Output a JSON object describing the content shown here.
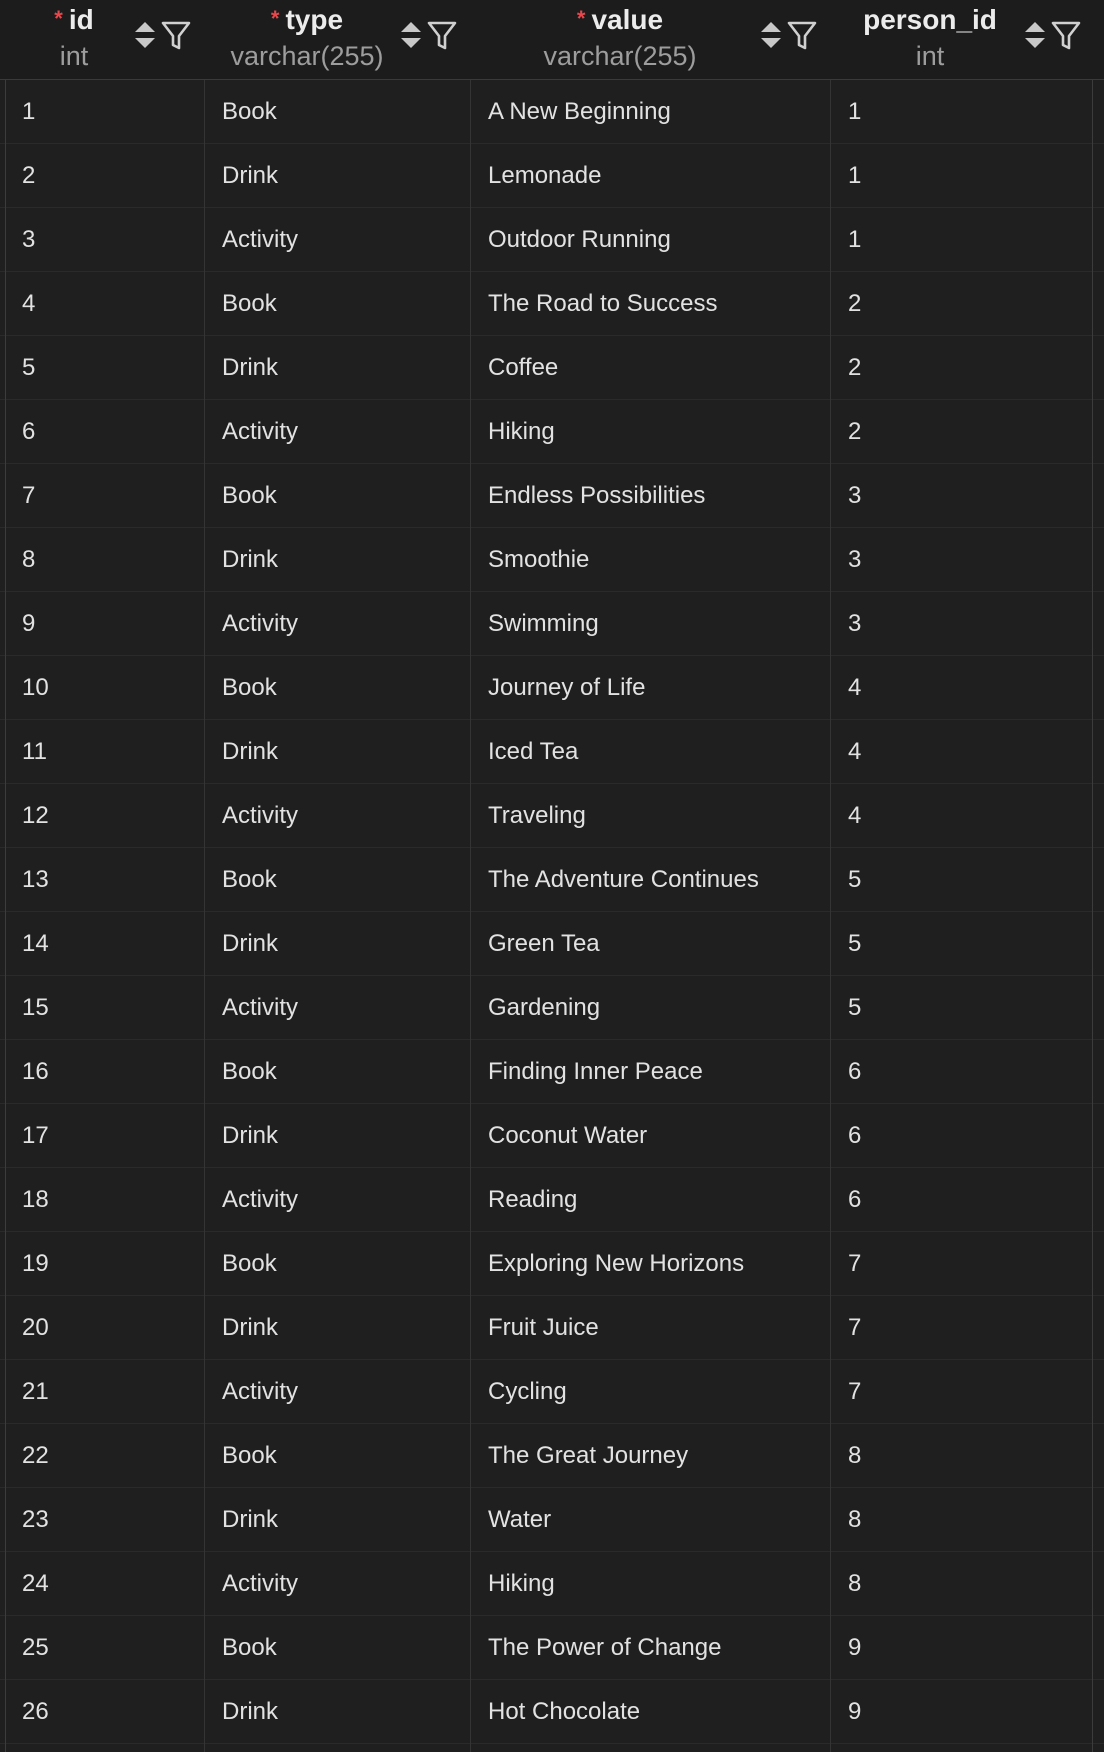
{
  "columns": [
    {
      "name": "id",
      "type": "int",
      "required": true
    },
    {
      "name": "type",
      "type": "varchar(255)",
      "required": true
    },
    {
      "name": "value",
      "type": "varchar(255)",
      "required": true
    },
    {
      "name": "person_id",
      "type": "int",
      "required": false
    }
  ],
  "required_marker": "*",
  "icons": {
    "sort": "sort-icon",
    "filter": "filter-icon"
  },
  "colors": {
    "background": "#1f1f1f",
    "text": "#e4e4e4",
    "muted": "#9d9d9d",
    "required": "#e5484d",
    "grid": "#343434"
  },
  "rows": [
    [
      "1",
      "Book",
      "A New Beginning",
      "1"
    ],
    [
      "2",
      "Drink",
      "Lemonade",
      "1"
    ],
    [
      "3",
      "Activity",
      "Outdoor Running",
      "1"
    ],
    [
      "4",
      "Book",
      "The Road to Success",
      "2"
    ],
    [
      "5",
      "Drink",
      "Coffee",
      "2"
    ],
    [
      "6",
      "Activity",
      "Hiking",
      "2"
    ],
    [
      "7",
      "Book",
      "Endless Possibilities",
      "3"
    ],
    [
      "8",
      "Drink",
      "Smoothie",
      "3"
    ],
    [
      "9",
      "Activity",
      "Swimming",
      "3"
    ],
    [
      "10",
      "Book",
      "Journey of Life",
      "4"
    ],
    [
      "11",
      "Drink",
      "Iced Tea",
      "4"
    ],
    [
      "12",
      "Activity",
      "Traveling",
      "4"
    ],
    [
      "13",
      "Book",
      "The Adventure Continues",
      "5"
    ],
    [
      "14",
      "Drink",
      "Green Tea",
      "5"
    ],
    [
      "15",
      "Activity",
      "Gardening",
      "5"
    ],
    [
      "16",
      "Book",
      "Finding Inner Peace",
      "6"
    ],
    [
      "17",
      "Drink",
      "Coconut Water",
      "6"
    ],
    [
      "18",
      "Activity",
      "Reading",
      "6"
    ],
    [
      "19",
      "Book",
      "Exploring New Horizons",
      "7"
    ],
    [
      "20",
      "Drink",
      "Fruit Juice",
      "7"
    ],
    [
      "21",
      "Activity",
      "Cycling",
      "7"
    ],
    [
      "22",
      "Book",
      "The Great Journey",
      "8"
    ],
    [
      "23",
      "Drink",
      "Water",
      "8"
    ],
    [
      "24",
      "Activity",
      "Hiking",
      "8"
    ],
    [
      "25",
      "Book",
      "The Power of Change",
      "9"
    ],
    [
      "26",
      "Drink",
      "Hot Chocolate",
      "9"
    ]
  ]
}
